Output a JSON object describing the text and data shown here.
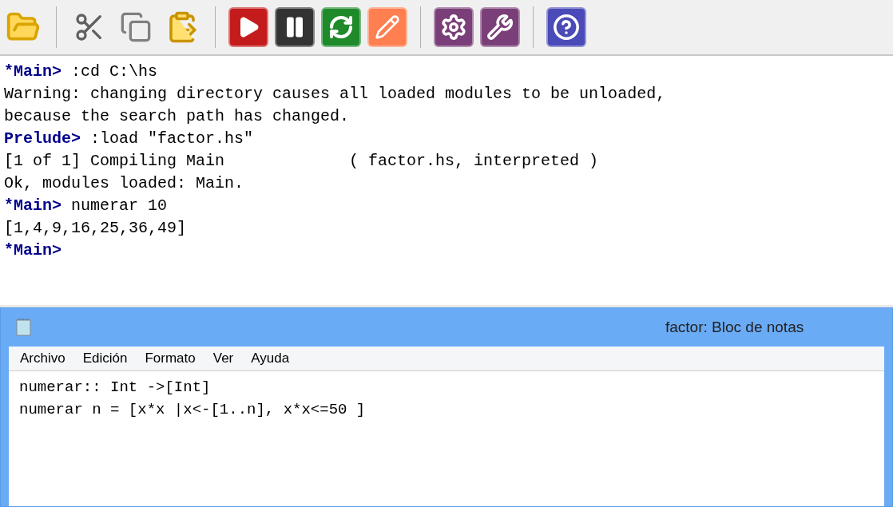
{
  "console": {
    "lines": [
      {
        "kind": "prompt",
        "prompt": "*Main>",
        "text": " :cd C:\\hs"
      },
      {
        "kind": "output",
        "text": "Warning: changing directory causes all loaded modules to be unloaded,"
      },
      {
        "kind": "output",
        "text": "because the search path has changed."
      },
      {
        "kind": "prompt",
        "prompt": "Prelude>",
        "text": " :load \"factor.hs\""
      },
      {
        "kind": "output",
        "text": "[1 of 1] Compiling Main             ( factor.hs, interpreted )"
      },
      {
        "kind": "output",
        "text": "Ok, modules loaded: Main."
      },
      {
        "kind": "prompt",
        "prompt": "*Main>",
        "text": " numerar 10"
      },
      {
        "kind": "output",
        "text": "[1,4,9,16,25,36,49]"
      },
      {
        "kind": "prompt",
        "prompt": "*Main>"
      }
    ]
  },
  "notepad": {
    "title": "factor: Bloc de notas",
    "menu": [
      "Archivo",
      "Edición",
      "Formato",
      "Ver",
      "Ayuda"
    ],
    "lines": [
      "numerar:: Int ->[Int]",
      "numerar n = [x*x |x<-[1..n], x*x<=50 ]"
    ]
  }
}
